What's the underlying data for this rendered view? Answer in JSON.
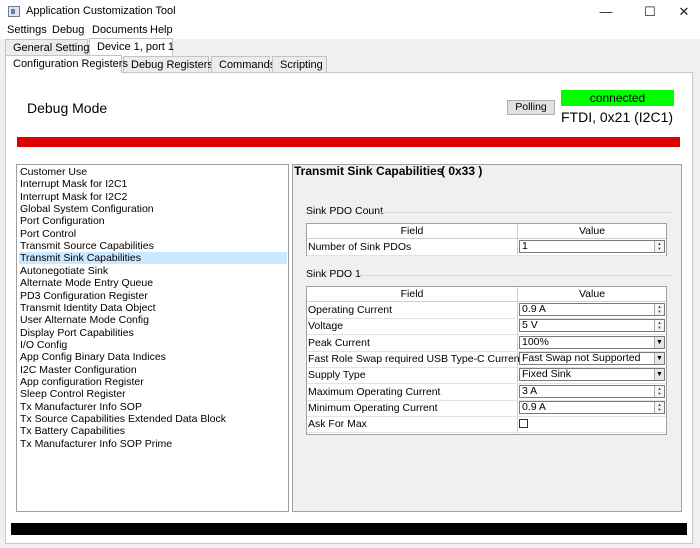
{
  "window": {
    "title": "Application Customization Tool",
    "controls": [
      "—",
      "☐",
      "✕"
    ]
  },
  "menu": [
    "Settings",
    "Debug",
    "Documents",
    "Help"
  ],
  "top_tabs": [
    "General Settings",
    "Device 1, port 1"
  ],
  "sub_tabs": [
    "Configuration Registers",
    "Debug Registers",
    "Commands",
    "Scripting"
  ],
  "header": {
    "mode": "Debug Mode",
    "polling_label": "Polling",
    "status": "connected",
    "device_info": "FTDI, 0x21 (I2C1)",
    "status_color": "#00ff00",
    "alert_bar_color": "#dd0000"
  },
  "registers": [
    "Customer Use",
    "Interrupt Mask for I2C1",
    "Interrupt Mask for I2C2",
    "Global System Configuration",
    "Port Configuration",
    "Port Control",
    "Transmit Source Capabilities",
    "Transmit Sink Capabilities",
    "Autonegotiate Sink",
    "Alternate Mode Entry Queue",
    "PD3 Configuration Register",
    "Transmit Identity Data Object",
    "User Alternate Mode Config",
    "Display Port Capabilities",
    "I/O Config",
    "App Config Binary Data Indices",
    "I2C Master Configuration",
    "App configuration Register",
    "Sleep Control Register",
    "Tx Manufacturer Info SOP",
    "Tx Source Capabilities Extended Data Block",
    "Tx Battery Capabilities",
    "Tx Manufacturer Info SOP Prime"
  ],
  "selected_register_index": 7,
  "panel": {
    "title": "Transmit Sink Capabilities",
    "address": "( 0x33 )",
    "group1": {
      "title": "Sink PDO Count",
      "col_field": "Field",
      "col_value": "Value",
      "rows": [
        {
          "field": "Number of Sink PDOs",
          "value": "1",
          "control": "spin"
        }
      ]
    },
    "group2": {
      "title": "Sink PDO 1",
      "col_field": "Field",
      "col_value": "Value",
      "rows": [
        {
          "field": "Operating Current",
          "value": "0.9 A",
          "control": "spin"
        },
        {
          "field": "Voltage",
          "value": "5 V",
          "control": "spin"
        },
        {
          "field": "Peak Current",
          "value": "100%",
          "control": "combo"
        },
        {
          "field": "Fast Role Swap required USB Type-C Current",
          "value": "Fast Swap not Supported",
          "control": "combo"
        },
        {
          "field": "Supply Type",
          "value": "Fixed Sink",
          "control": "combo"
        },
        {
          "field": "Maximum Operating Current",
          "value": "3 A",
          "control": "spin"
        },
        {
          "field": "Minimum Operating Current",
          "value": "0.9 A",
          "control": "spin"
        },
        {
          "field": "Ask For Max",
          "value": "",
          "control": "checkbox",
          "checked": false
        }
      ]
    }
  }
}
